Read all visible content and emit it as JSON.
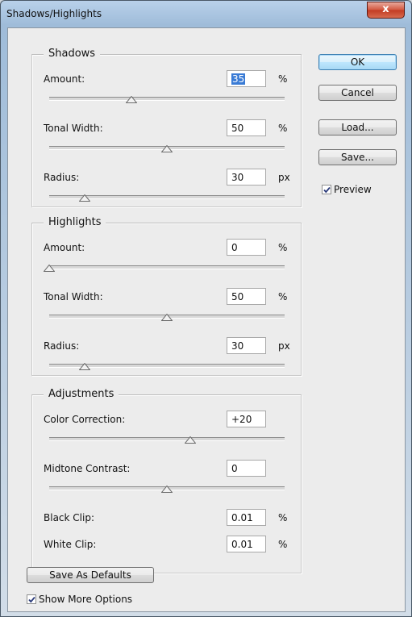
{
  "window": {
    "title": "Shadows/Highlights",
    "close_glyph": "x"
  },
  "shadows": {
    "title": "Shadows",
    "amount": {
      "label": "Amount:",
      "value": "35",
      "unit": "%",
      "slider_fraction": 0.35
    },
    "tonal_width": {
      "label": "Tonal Width:",
      "value": "50",
      "unit": "%",
      "slider_fraction": 0.5
    },
    "radius": {
      "label": "Radius:",
      "value": "30",
      "unit": "px",
      "slider_fraction": 0.15
    }
  },
  "highlights": {
    "title": "Highlights",
    "amount": {
      "label": "Amount:",
      "value": "0",
      "unit": "%",
      "slider_fraction": 0.0
    },
    "tonal_width": {
      "label": "Tonal Width:",
      "value": "50",
      "unit": "%",
      "slider_fraction": 0.5
    },
    "radius": {
      "label": "Radius:",
      "value": "30",
      "unit": "px",
      "slider_fraction": 0.15
    }
  },
  "adjustments": {
    "title": "Adjustments",
    "color_correction": {
      "label": "Color Correction:",
      "value": "+20",
      "slider_fraction": 0.6
    },
    "midtone_contrast": {
      "label": "Midtone Contrast:",
      "value": "0",
      "slider_fraction": 0.5
    },
    "black_clip": {
      "label": "Black Clip:",
      "value": "0.01",
      "unit": "%"
    },
    "white_clip": {
      "label": "White Clip:",
      "value": "0.01",
      "unit": "%"
    }
  },
  "buttons": {
    "ok": "OK",
    "cancel": "Cancel",
    "load": "Load...",
    "save": "Save...",
    "save_defaults": "Save As Defaults"
  },
  "checkboxes": {
    "preview": {
      "label": "Preview",
      "checked": true
    },
    "more_options": {
      "label": "Show More Options",
      "checked": true
    }
  },
  "colors": {
    "accent": "#3a7bd5",
    "close": "#c23a22"
  }
}
